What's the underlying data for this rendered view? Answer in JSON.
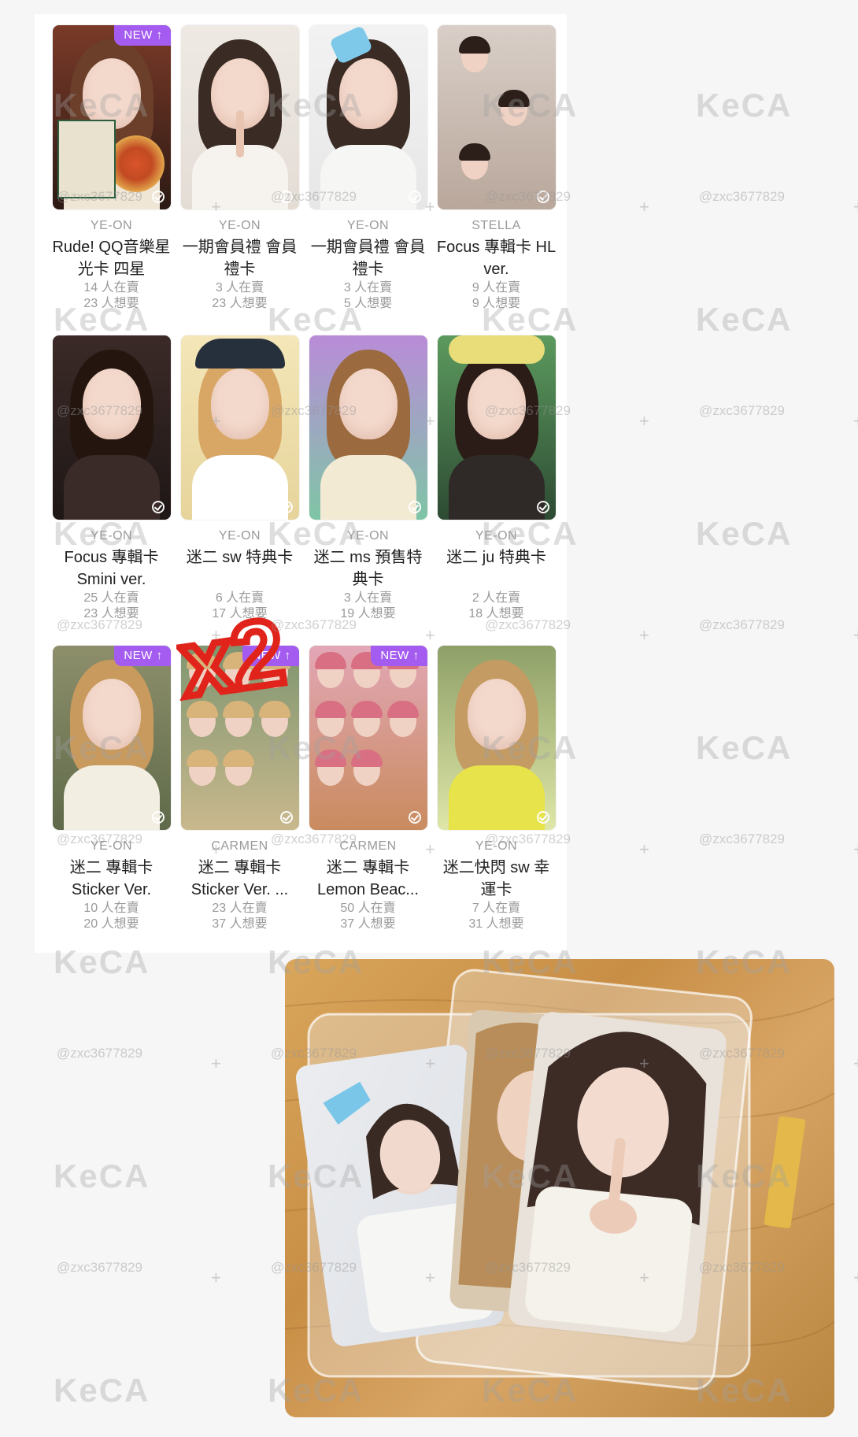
{
  "cards": [
    {
      "member": "YE-ON",
      "title": "Rude! QQ音樂星光卡 四星",
      "selling": "14 人在賣",
      "wanting": "23 人想要",
      "badge": "NEW ↑",
      "scene": "closeup-pizza"
    },
    {
      "member": "YE-ON",
      "title": "一期會員禮 會員禮卡",
      "selling": "3 人在賣",
      "wanting": "23 人想要",
      "badge": "",
      "scene": "closeup-white"
    },
    {
      "member": "YE-ON",
      "title": "一期會員禮 會員禮卡",
      "selling": "3 人在賣",
      "wanting": "5 人想要",
      "badge": "",
      "scene": "waterpistol"
    },
    {
      "member": "STELLA",
      "title": "Focus 專輯卡 HL ver.",
      "selling": "9 人在賣",
      "wanting": "9 人想要",
      "badge": "",
      "scene": "group-selfie"
    },
    {
      "member": "YE-ON",
      "title": "Focus 專輯卡 Smini ver.",
      "selling": "25 人在賣",
      "wanting": "23 人想要",
      "badge": "",
      "scene": "wink-dark"
    },
    {
      "member": "YE-ON",
      "title": "迷二 sw 特典卡",
      "selling": "6 人在賣",
      "wanting": "17 人想要",
      "badge": "",
      "scene": "cap-sailor"
    },
    {
      "member": "YE-ON",
      "title": "迷二 ms 預售特典卡",
      "selling": "3 人在賣",
      "wanting": "19 人想要",
      "badge": "",
      "scene": "peace-sign"
    },
    {
      "member": "YE-ON",
      "title": "迷二 ju 特典卡",
      "selling": "2 人在賣",
      "wanting": "18 人想要",
      "badge": "",
      "scene": "wink-yellow"
    },
    {
      "member": "YE-ON",
      "title": "迷二 專輯卡 Sticker Ver.",
      "selling": "10 人在賣",
      "wanting": "20 人想要",
      "badge": "NEW ↑",
      "scene": "blonde-curly"
    },
    {
      "member": "CARMEN",
      "title": "迷二 專輯卡 Sticker Ver. ...",
      "selling": "23 人在賣",
      "wanting": "37 人想要",
      "badge": "NEW ↑",
      "scene": "group-outdoor"
    },
    {
      "member": "CARMEN",
      "title": "迷二 專輯卡 Lemon Beac...",
      "selling": "50 人在賣",
      "wanting": "37 人想要",
      "badge": "NEW ↑",
      "scene": "group-pink"
    },
    {
      "member": "YE-ON",
      "title": "迷二快閃 sw 幸運卡",
      "selling": "7 人在賣",
      "wanting": "31 人想要",
      "badge": "",
      "scene": "yellow-jacket"
    }
  ],
  "annotation": {
    "text": "x2"
  },
  "watermark": {
    "brand": "KeCA",
    "handle": "@zxc3677829"
  },
  "colors": {
    "badge": "#a45cf0",
    "annotation": "#e0241b",
    "table": "#c8924a"
  }
}
